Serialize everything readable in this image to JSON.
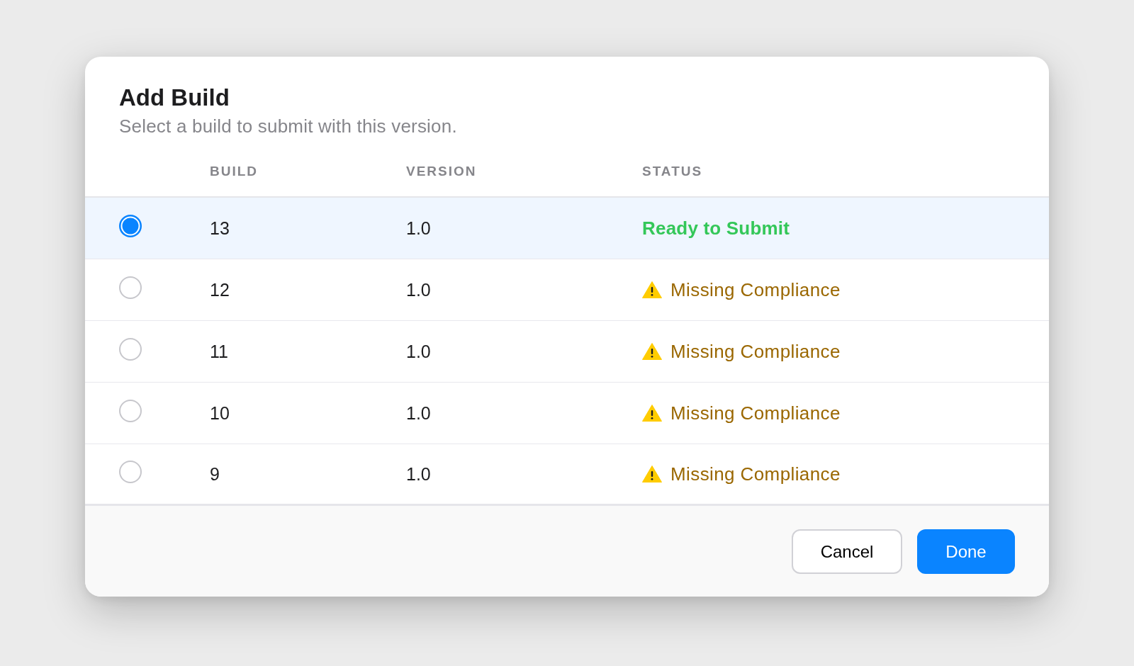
{
  "dialog": {
    "title": "Add Build",
    "subtitle": "Select a build to submit with this version."
  },
  "table": {
    "columns": [
      "BUILD",
      "VERSION",
      "STATUS"
    ],
    "rows": [
      {
        "selected": true,
        "build": "13",
        "version": "1.0",
        "status": {
          "kind": "ready",
          "text": "Ready to Submit"
        }
      },
      {
        "selected": false,
        "build": "12",
        "version": "1.0",
        "status": {
          "kind": "warning",
          "text": "Missing Compliance"
        }
      },
      {
        "selected": false,
        "build": "11",
        "version": "1.0",
        "status": {
          "kind": "warning",
          "text": "Missing Compliance"
        }
      },
      {
        "selected": false,
        "build": "10",
        "version": "1.0",
        "status": {
          "kind": "warning",
          "text": "Missing Compliance"
        }
      },
      {
        "selected": false,
        "build": "9",
        "version": "1.0",
        "status": {
          "kind": "warning",
          "text": "Missing Compliance"
        }
      }
    ]
  },
  "buttons": [
    {
      "kind": "secondary",
      "label": "Cancel"
    },
    {
      "kind": "primary",
      "label": "Done"
    }
  ]
}
